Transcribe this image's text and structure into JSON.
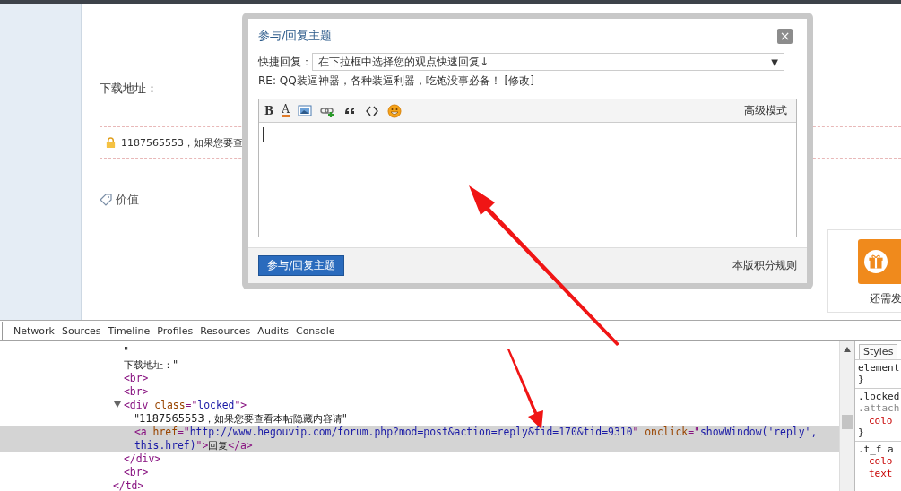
{
  "page": {
    "download_label": "下载地址：",
    "locked_text": "1187565553，如果您要查",
    "tag_label": "价值",
    "side_card": {
      "caption": "还需发"
    }
  },
  "dialog": {
    "title": "参与/回复主题",
    "close": "×",
    "quick_reply_label": "快捷回复：",
    "quick_reply_select": "在下拉框中选择您的观点快速回复↓",
    "quick_reply_caret": "▼",
    "subject": "RE: QQ装逼神器，各种装逼利器，吃饱没事必备！",
    "edit_link": "[修改]",
    "tools": [
      {
        "kind": "bold",
        "glyph": "B"
      },
      {
        "kind": "fontcolor",
        "glyph": "A"
      },
      {
        "kind": "image"
      },
      {
        "kind": "link"
      },
      {
        "kind": "quote"
      },
      {
        "kind": "code"
      },
      {
        "kind": "emoji"
      }
    ],
    "advanced_mode": "高级模式",
    "submit": "参与/回复主题",
    "rules_link": "本版积分规则"
  },
  "devtools": {
    "tabs": [
      {
        "label": "Network",
        "selected": false
      },
      {
        "label": "Sources",
        "selected": false
      },
      {
        "label": "Timeline",
        "selected": false
      },
      {
        "label": "Profiles",
        "selected": false
      },
      {
        "label": "Resources",
        "selected": false
      },
      {
        "label": "Audits",
        "selected": false
      },
      {
        "label": "Console",
        "selected": false
      }
    ],
    "tree": [
      {
        "children": [
          {
            "segments": [
              {
                "kind": "text",
                "t": "\""
              }
            ]
          },
          {
            "segments": [
              {
                "kind": "text",
                "t": "下载地址：\""
              }
            ]
          },
          {
            "segments": [
              {
                "kind": "tag",
                "t": "<br>"
              }
            ]
          },
          {
            "segments": [
              {
                "kind": "tag",
                "t": "<br>"
              }
            ]
          },
          {
            "expanded": true,
            "segments": [
              {
                "kind": "tag",
                "t": "<div "
              },
              {
                "kind": "attr",
                "t": "class"
              },
              {
                "kind": "tag",
                "t": "=\""
              },
              {
                "kind": "value",
                "t": "locked"
              },
              {
                "kind": "tag",
                "t": "\">"
              }
            ],
            "children": [
              {
                "segments": [
                  {
                    "kind": "text",
                    "t": "\"1187565553，如果您要查看本帖隐藏内容请\""
                  }
                ]
              },
              {
                "selected": true,
                "segments": [
                  {
                    "kind": "tag",
                    "t": "<a "
                  },
                  {
                    "kind": "attr",
                    "t": "href"
                  },
                  {
                    "kind": "tag",
                    "t": "=\""
                  },
                  {
                    "kind": "value",
                    "t": "http://www.hegouvip.com/forum.php?mod=post&action=reply&fid=170&tid=9310"
                  },
                  {
                    "kind": "tag",
                    "t": "\" "
                  },
                  {
                    "kind": "attr",
                    "t": "onclick"
                  },
                  {
                    "kind": "tag",
                    "t": "=\""
                  },
                  {
                    "kind": "value",
                    "t": "showWindow('reply', this.href)"
                  },
                  {
                    "kind": "tag",
                    "t": "\">"
                  },
                  {
                    "kind": "text",
                    "t": "回复"
                  },
                  {
                    "kind": "tag",
                    "t": "</a>"
                  }
                ]
              }
            ],
            "closing": [
              {
                "kind": "tag",
                "t": "</div>"
              }
            ]
          },
          {
            "segments": [
              {
                "kind": "tag",
                "t": "<br>"
              }
            ]
          }
        ],
        "closing": [
          {
            "kind": "tag",
            "t": "</td>"
          }
        ]
      }
    ],
    "styles": {
      "tab": "Styles",
      "rules": [
        {
          "lines": [
            {
              "kind": "selector",
              "text": "element"
            },
            {
              "kind": "brace",
              "text": "}"
            }
          ]
        },
        {
          "lines": [
            {
              "kind": "selector",
              "text": ".locked"
            },
            {
              "kind": "muted",
              "text": ".attach"
            },
            {
              "kind": "prop",
              "text": "colo",
              "struck": false
            },
            {
              "kind": "brace",
              "text": "}"
            }
          ]
        },
        {
          "lines": [
            {
              "kind": "selector",
              "text": ".t_f a"
            },
            {
              "kind": "prop",
              "text": "colo",
              "struck": true
            },
            {
              "kind": "prop",
              "text": "text",
              "struck": false
            }
          ]
        }
      ]
    }
  }
}
